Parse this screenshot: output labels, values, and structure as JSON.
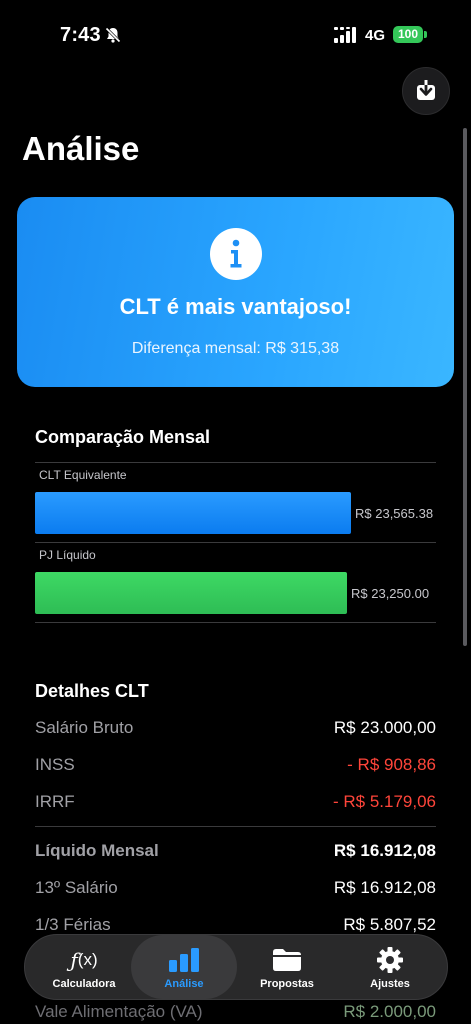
{
  "status_bar": {
    "time": "7:43",
    "network": "4G",
    "battery": "100"
  },
  "header": {
    "title": "Análise"
  },
  "info_card": {
    "title": "CLT é mais vantajoso!",
    "subtitle": "Diferença mensal: R$ 315,38"
  },
  "comparison": {
    "title": "Comparação Mensal",
    "chart_data": {
      "type": "bar",
      "categories": [
        "CLT Equivalente",
        "PJ Líquido"
      ],
      "values": [
        23565.38,
        23250.0
      ],
      "value_labels": [
        "R$ 23,565.38",
        "R$ 23,250.00"
      ],
      "colors": [
        "#1a8cff",
        "#34c759"
      ]
    }
  },
  "details": {
    "title": "Detalhes CLT",
    "rows": [
      {
        "label": "Salário Bruto",
        "value": "R$ 23.000,00"
      },
      {
        "label": "INSS",
        "value": "- R$ 908,86"
      },
      {
        "label": "IRRF",
        "value": "- R$ 5.179,06"
      },
      {
        "label": "Líquido Mensal",
        "value": "R$ 16.912,08"
      },
      {
        "label": "13º Salário",
        "value": "R$ 16.912,08"
      },
      {
        "label": "1/3 Férias",
        "value": "R$ 5.807,52"
      },
      {
        "label": "Vale Alimentação (VA)",
        "value": "R$ 2.000,00"
      }
    ]
  },
  "tab_bar": {
    "tabs": [
      {
        "label": "Calculadora",
        "icon": "function-icon"
      },
      {
        "label": "Análise",
        "icon": "chart-bar-icon"
      },
      {
        "label": "Propostas",
        "icon": "folder-icon"
      },
      {
        "label": "Ajustes",
        "icon": "gear-icon"
      }
    ],
    "active_index": 1
  },
  "colors": {
    "accent": "#1a8cff",
    "success": "#34c759",
    "danger": "#ff453a"
  }
}
